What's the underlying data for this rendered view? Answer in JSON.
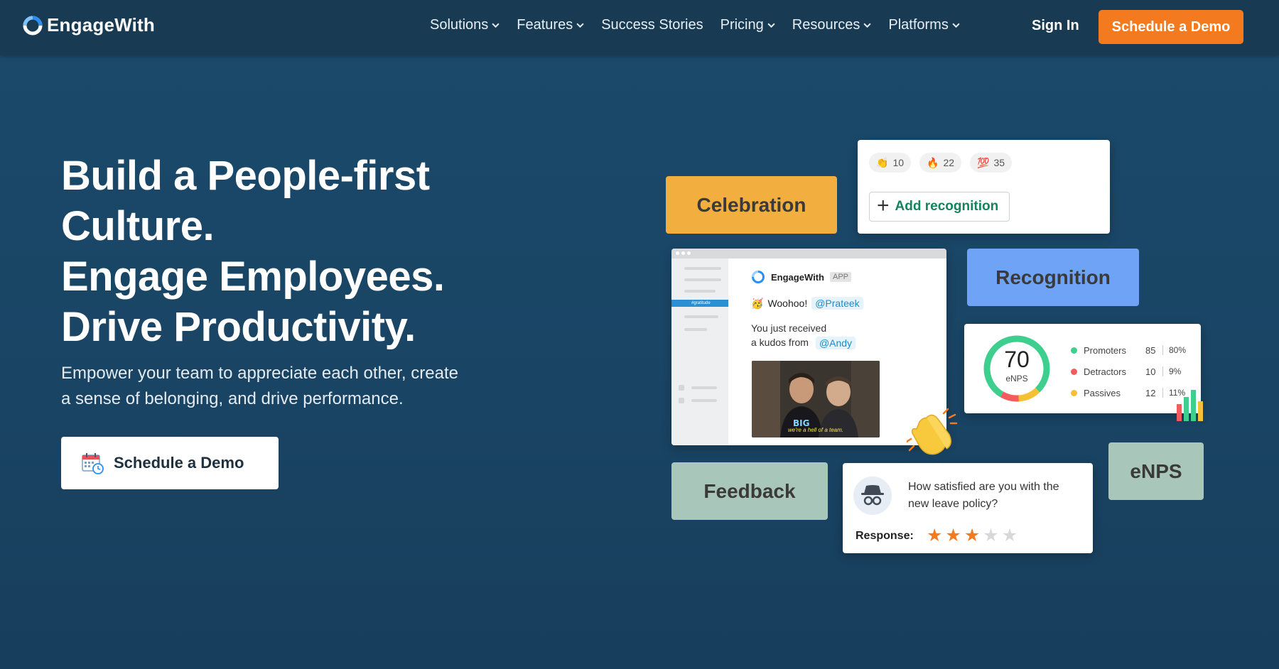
{
  "brand": {
    "name": "EngageWith"
  },
  "nav": {
    "items": [
      {
        "label": "Solutions",
        "dropdown": true
      },
      {
        "label": "Features",
        "dropdown": true
      },
      {
        "label": "Success Stories",
        "dropdown": false
      },
      {
        "label": "Pricing",
        "dropdown": true
      },
      {
        "label": "Resources",
        "dropdown": true
      },
      {
        "label": "Platforms",
        "dropdown": true
      }
    ],
    "sign_in": "Sign In",
    "cta": "Schedule a Demo"
  },
  "hero": {
    "title_lines": [
      "Build a People-first",
      "Culture.",
      "Engage Employees.",
      "Drive Productivity."
    ],
    "subtitle_line1": "Empower your team to appreciate each other, create",
    "subtitle_line2": "a sense of belonging, and drive performance.",
    "cta": "Schedule a Demo"
  },
  "illustration": {
    "tags": {
      "celebration": "Celebration",
      "recognition": "Recognition",
      "feedback": "Feedback",
      "enps": "eNPS"
    },
    "reactions": [
      {
        "emoji": "👏",
        "count": "10"
      },
      {
        "emoji": "🔥",
        "count": "22"
      },
      {
        "emoji": "💯",
        "count": "35"
      }
    ],
    "add_recognition": "Add recognition",
    "chat": {
      "brand": "EngageWith",
      "badge": "APP",
      "channel": "#gratitude",
      "emoji": "🥳",
      "woohoo": "Woohoo!",
      "mention_to": "@Prateek",
      "line1": "You just received",
      "line2": "a kudos from",
      "mention_from": "@Andy",
      "gif_caption": "we're a hell of a team."
    },
    "enps": {
      "score": "70",
      "label": "eNPS",
      "rows": [
        {
          "name": "Promoters",
          "count": "85",
          "pct": "80%",
          "color": "#3ecf8e"
        },
        {
          "name": "Detractors",
          "count": "10",
          "pct": "9%",
          "color": "#f25c5c"
        },
        {
          "name": "Passives",
          "count": "12",
          "pct": "11%",
          "color": "#f5c035"
        }
      ]
    },
    "survey": {
      "question": "How satisfied are you with the new leave policy?",
      "response_label": "Response:",
      "rating": 3,
      "max_rating": 5
    }
  },
  "colors": {
    "accent_orange": "#f47a1f",
    "background": "#1a4464",
    "celebration": "#f2ae3f",
    "recognition": "#6ea3f5",
    "feedback": "#a9c6ba"
  }
}
